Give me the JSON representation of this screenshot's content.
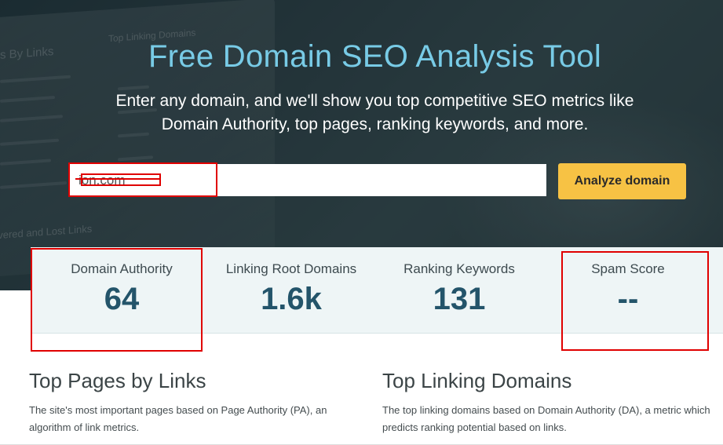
{
  "hero": {
    "title": "Free Domain SEO Analysis Tool",
    "subtitle_line1": "Enter any domain, and we'll show you top competitive SEO metrics like",
    "subtitle_line2": "Domain Authority, top pages, ranking keywords, and more."
  },
  "search": {
    "value": "ion.com",
    "button_label": "Analyze domain"
  },
  "background_text": {
    "col1_title": "s By Links",
    "col2_title": "Top Linking Domains",
    "col3_title": "overed and Lost Links"
  },
  "metrics": [
    {
      "label": "Domain Authority",
      "value": "64"
    },
    {
      "label": "Linking Root Domains",
      "value": "1.6k"
    },
    {
      "label": "Ranking Keywords",
      "value": "131"
    },
    {
      "label": "Spam Score",
      "value": "--"
    }
  ],
  "sections": {
    "top_pages": {
      "title": "Top Pages by Links",
      "description": "The site's most important pages based on Page Authority (PA), an algorithm of link metrics."
    },
    "top_domains": {
      "title": "Top Linking Domains",
      "description": "The top linking domains based on Domain Authority (DA), a metric which predicts ranking potential based on links."
    }
  },
  "colors": {
    "title_blue": "#78cbe6",
    "button_yellow": "#f7c244",
    "metric_value": "#23546a",
    "annotation_red": "#e00000"
  }
}
